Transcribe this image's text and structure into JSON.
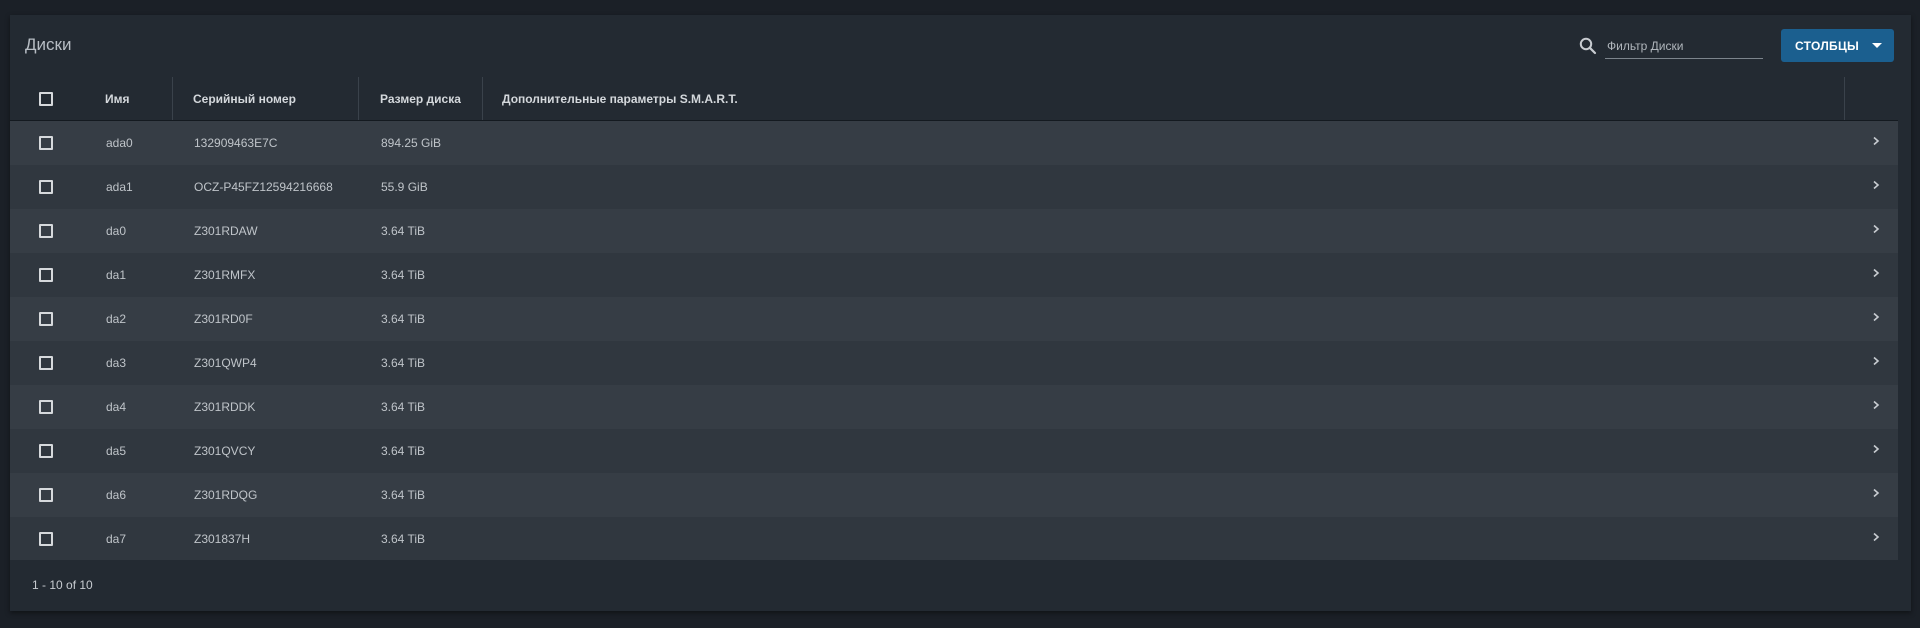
{
  "page": {
    "title": "Диски"
  },
  "filter": {
    "placeholder": "Фильтр Диски",
    "value": ""
  },
  "columns_button": {
    "label": "СТОЛБЦЫ"
  },
  "table": {
    "headers": {
      "name": "Имя",
      "serial": "Серийный номер",
      "size": "Размер диска",
      "smart": "Дополнительные параметры S.M.A.R.T."
    },
    "rows": [
      {
        "name": "ada0",
        "serial": "132909463E7C",
        "size": "894.25 GiB",
        "smart": ""
      },
      {
        "name": "ada1",
        "serial": "OCZ-P45FZ12594216668",
        "size": "55.9 GiB",
        "smart": ""
      },
      {
        "name": "da0",
        "serial": "Z301RDAW",
        "size": "3.64 TiB",
        "smart": ""
      },
      {
        "name": "da1",
        "serial": "Z301RMFX",
        "size": "3.64 TiB",
        "smart": ""
      },
      {
        "name": "da2",
        "serial": "Z301RD0F",
        "size": "3.64 TiB",
        "smart": ""
      },
      {
        "name": "da3",
        "serial": "Z301QWP4",
        "size": "3.64 TiB",
        "smart": ""
      },
      {
        "name": "da4",
        "serial": "Z301RDDK",
        "size": "3.64 TiB",
        "smart": ""
      },
      {
        "name": "da5",
        "serial": "Z301QVCY",
        "size": "3.64 TiB",
        "smart": ""
      },
      {
        "name": "da6",
        "serial": "Z301RDQG",
        "size": "3.64 TiB",
        "smart": ""
      },
      {
        "name": "da7",
        "serial": "Z301837H",
        "size": "3.64 TiB",
        "smart": ""
      }
    ]
  },
  "paginator": {
    "range_label": "1 - 10 of 10"
  },
  "icons": {
    "search": "search-icon",
    "caret": "caret-down-icon",
    "row_expand": "chevron-right-icon"
  },
  "colors": {
    "accent": "#1b5f8f",
    "background": "#1b2027",
    "card": "#232a32",
    "row_odd": "#363d45",
    "row_even": "#30373f"
  }
}
